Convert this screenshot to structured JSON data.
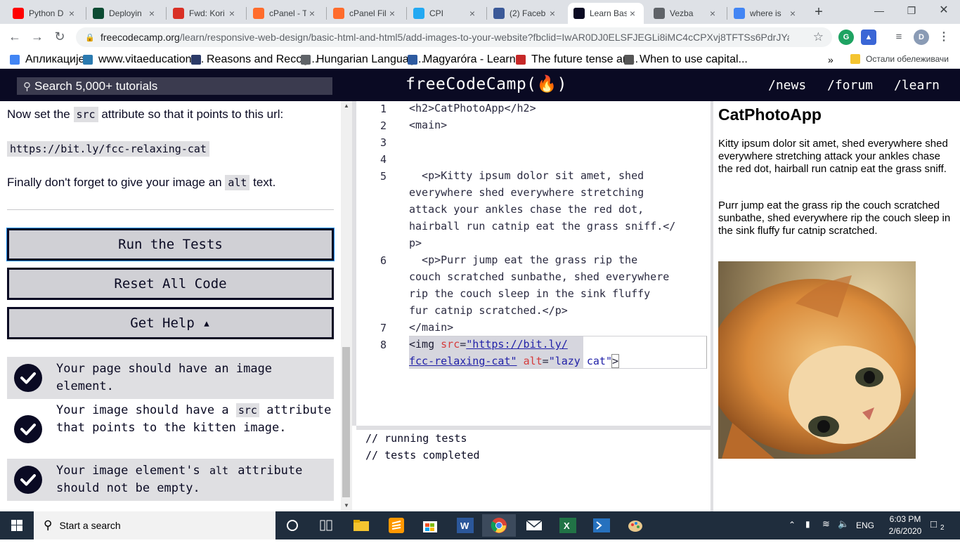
{
  "browser": {
    "tabs": [
      {
        "title": "Python D",
        "icon": "youtube-icon",
        "color": "#ff0000"
      },
      {
        "title": "Deployin",
        "icon": "django-icon",
        "color": "#0c4b33"
      },
      {
        "title": "Fwd: Kori",
        "icon": "gmail-icon",
        "color": "#d93025"
      },
      {
        "title": "cPanel - T",
        "icon": "cpanel-icon",
        "color": "#ff6c2c"
      },
      {
        "title": "cPanel Fil",
        "icon": "cpanel-icon",
        "color": "#ff6c2c"
      },
      {
        "title": "CPI",
        "icon": "vscode-icon",
        "color": "#23a9f2"
      },
      {
        "title": "(2) Faceb",
        "icon": "facebook-icon",
        "color": "#3b5998"
      },
      {
        "title": "Learn Bas",
        "icon": "freecodecamp-icon",
        "color": "#0a0a23"
      },
      {
        "title": "Vezba",
        "icon": "globe-icon",
        "color": "#5f6368"
      },
      {
        "title": "where is",
        "icon": "google-icon",
        "color": "#4285f4"
      }
    ],
    "url_host": "freecodecamp.org",
    "url_path": "/learn/responsive-web-design/basic-html-and-html5/add-images-to-your-website?fbclid=IwAR0DJ0ELSFJEGLi8iMC4cCPXvj8TFTSs6PdrJYa2O...",
    "profile_letter": "D",
    "bookmarks": [
      {
        "label": "Апликације",
        "icon": "apps-grid-icon",
        "color": "#4285f4"
      },
      {
        "label": "www.vitaeducation....",
        "icon": "vita-icon",
        "color": "#2a7ab0"
      },
      {
        "label": "Reasons and Recog...",
        "icon": "o-icon",
        "color": "#2b3a67"
      },
      {
        "label": "Hungarian Languag...",
        "icon": "globe-icon",
        "color": "#5f6368"
      },
      {
        "label": "Magyaróra - Learn...",
        "icon": "grid-icon",
        "color": "#2d5aa0"
      },
      {
        "label": "The future tense an...",
        "icon": "ik-icon",
        "color": "#c62828"
      },
      {
        "label": "When to use capital...",
        "icon": "ef-icon",
        "color": "#555555"
      }
    ],
    "bookmarks_more": "»",
    "other_bookmarks": "Остали обележивачи"
  },
  "fcc": {
    "search_placeholder": "Search 5,000+ tutorials",
    "logo": "freeCodeCamp(🔥)",
    "nav": [
      "/news",
      "/forum",
      "/learn"
    ]
  },
  "instructions": {
    "line1_pre": "Now set the ",
    "line1_code": "src",
    "line1_post": " attribute so that it points to this url:",
    "url_code": "https://bit.ly/fcc-relaxing-cat",
    "line3_pre": "Finally don't forget to give your image an ",
    "line3_code": "alt",
    "line3_post": " text."
  },
  "buttons": {
    "run": "Run the Tests",
    "reset": "Reset All Code",
    "help": "Get Help ▴"
  },
  "tests": [
    {
      "pre": "Your page should have an image element.",
      "code": "",
      "post": ""
    },
    {
      "pre": "Your image should have a ",
      "code": "src",
      "post": " attribute that points to the kitten image."
    },
    {
      "pre": "Your image element's ",
      "code": "alt",
      "post": " attribute should not be empty."
    }
  ],
  "editor": {
    "line_numbers": [
      "1",
      "2",
      "3",
      "4",
      "5",
      "6",
      "7",
      "8"
    ],
    "l1": "<h2>CatPhotoApp</h2>",
    "l2": "<main>",
    "l5a": "  <p>Kitty ipsum dolor sit amet, shed",
    "l5b": "everywhere shed everywhere stretching",
    "l5c": "attack your ankles chase the red dot,",
    "l5d": "hairball run catnip eat the grass sniff.</",
    "l5e": "p>",
    "l6a": "  <p>Purr jump eat the grass rip the",
    "l6b": "couch scratched sunbathe, shed everywhere",
    "l6c": "rip the couch sleep in the sink fluffy",
    "l6d": "fur catnip scratched.</p>",
    "l7": "</main>",
    "l8_tag_open": "<img ",
    "l8_attr1": "src",
    "l8_eq1": "=",
    "l8_str1a": "\"https://bit.ly/",
    "l8_str1b": "fcc-relaxing-cat\"",
    "l8_attr2": "alt",
    "l8_eq2": "=",
    "l8_str2": "\"lazy cat\"",
    "l8_close": ">"
  },
  "console": [
    "// running tests",
    "// tests completed"
  ],
  "preview": {
    "title": "CatPhotoApp",
    "p1": "Kitty ipsum dolor sit amet, shed everywhere shed everywhere stretching attack your ankles chase the red dot, hairball run catnip eat the grass sniff.",
    "p2": "Purr jump eat the grass rip the couch scratched sunbathe, shed everywhere rip the couch sleep in the sink fluffy fur catnip scratched."
  },
  "taskbar": {
    "search_placeholder": "Start a search",
    "lang": "ENG",
    "time": "6:03 PM",
    "date": "2/6/2020",
    "notifications": "2"
  }
}
